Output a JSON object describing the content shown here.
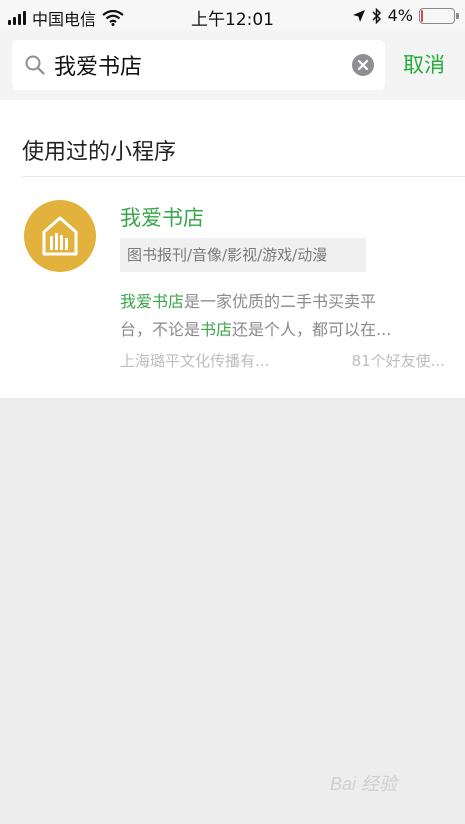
{
  "status_bar": {
    "carrier": "中国电信",
    "time": "上午12:01",
    "battery_percent": "4%",
    "battery_level": 0.04
  },
  "search": {
    "query": "我爱书店",
    "cancel_label": "取消"
  },
  "section": {
    "title": "使用过的小程序"
  },
  "result": {
    "name": "我爱书店",
    "tags": "图书报刊/音像/影视/游戏/动漫",
    "desc_line1_highlight": "我爱书店",
    "desc_line1_rest": "是一家优质的二手书买卖平",
    "desc_line2_prefix": "台，不论是",
    "desc_line2_highlight": "书店",
    "desc_line2_rest": "还是个人，都可以在...",
    "publisher": "上海璐平文化传播有...",
    "friends_used": "81个好友使..."
  },
  "watermark": "Bai 经验",
  "colors": {
    "accent_green": "#22ac38",
    "icon_yellow": "#e3b23c",
    "battery_red": "#e0464e"
  }
}
